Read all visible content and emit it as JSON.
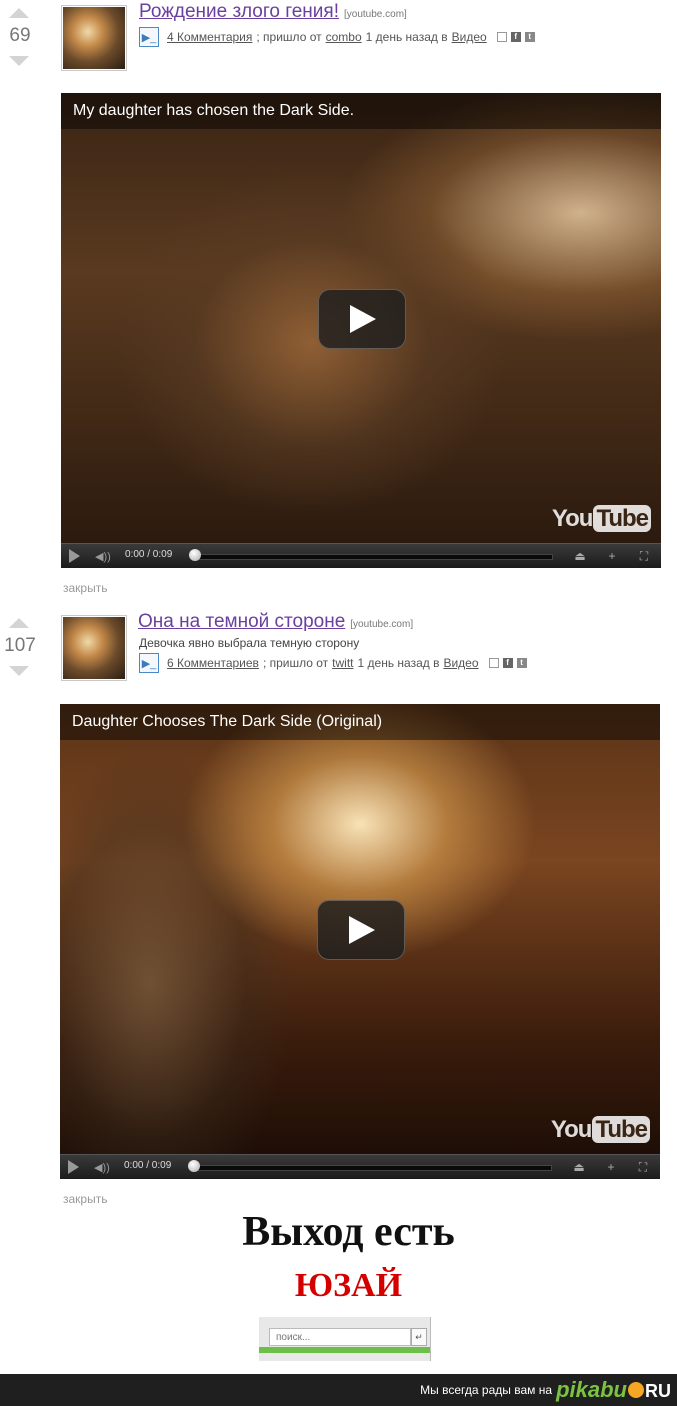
{
  "posts": [
    {
      "score": "69",
      "title": "Рождение злого гения!",
      "source": "[youtube.com]",
      "subtitle": "",
      "comments": "4 Комментария",
      "came_from_label": "; пришло от",
      "author": "combo",
      "time_label": "1 день назад в",
      "category": "Видео",
      "video": {
        "title": "My daughter has chosen the Dark Side.",
        "time": "0:00 / 0:09",
        "brand": "YouTube"
      },
      "close": "закрыть"
    },
    {
      "score": "107",
      "title": "Она на темной стороне",
      "source": "[youtube.com]",
      "subtitle": "Девочка явно выбрала темную сторону",
      "comments": "6 Комментариев",
      "came_from_label": "; пришло от",
      "author": "twitt",
      "time_label": "1 день назад в",
      "category": "Видео",
      "video": {
        "title": "Daughter Chooses The Dark Side (Original)",
        "time": "0:00 / 0:09",
        "brand": "YouTube"
      },
      "close": "закрыть"
    }
  ],
  "ad": {
    "line1": "Выход есть",
    "line2": "ЮЗАЙ",
    "search_placeholder": "поиск..."
  },
  "footer": {
    "text": "Мы всегда рады вам на",
    "logo": "pikabu",
    "logo_suffix": "RU"
  },
  "colors": {
    "title_link": "#6a3fa0",
    "ad_red": "#d40000",
    "pikabu_green": "#7cc242"
  }
}
